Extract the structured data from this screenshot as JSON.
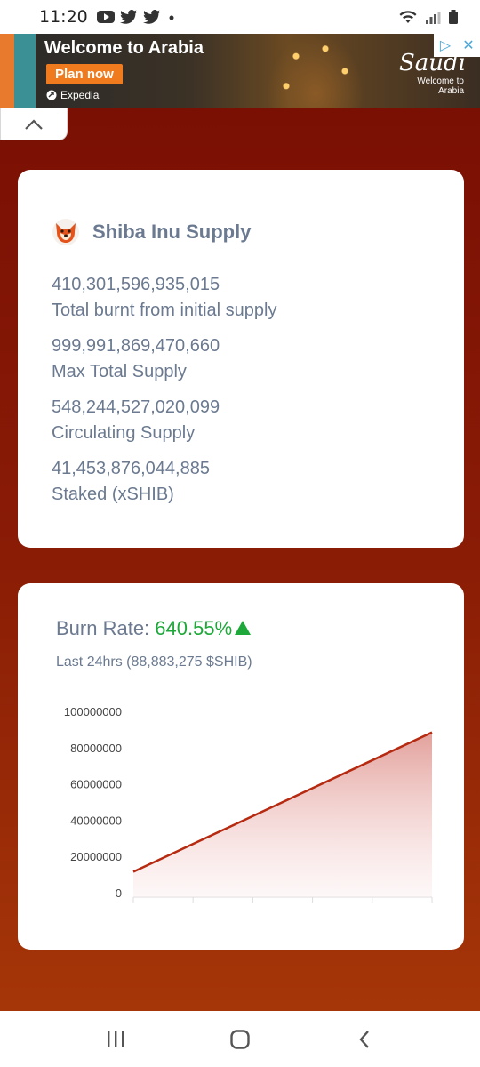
{
  "status_bar": {
    "time": "11:20",
    "left_icons": [
      "youtube-icon",
      "twitter-icon",
      "twitter-icon",
      "dot-icon"
    ],
    "right_icons": [
      "wifi-icon",
      "signal-icon",
      "battery-icon"
    ]
  },
  "ad": {
    "title": "Welcome to Arabia",
    "cta": "Plan now",
    "advertiser": "Expedia",
    "brand": "Saudi",
    "tagline": "Welcome to Arabia",
    "controls": [
      "adchoices-icon",
      "close-icon"
    ]
  },
  "supply_card": {
    "title": "Shiba Inu Supply",
    "stats": [
      {
        "value": "410,301,596,935,015",
        "label": "Total burnt from initial supply"
      },
      {
        "value": "999,991,869,470,660",
        "label": "Max Total Supply"
      },
      {
        "value": "548,244,527,020,099",
        "label": "Circulating Supply"
      },
      {
        "value": "41,453,876,044,885",
        "label": "Staked (xSHIB)"
      }
    ]
  },
  "burn_card": {
    "title_prefix": "Burn Rate: ",
    "rate": "640.55%",
    "subtitle": "Last 24hrs (88,883,275 $SHIB)",
    "trend_color": "#1fa83a"
  },
  "chart_data": {
    "type": "area",
    "x": [
      0,
      5
    ],
    "values": [
      12000000,
      88883275
    ],
    "ylim": [
      0,
      100000000
    ],
    "yticks": [
      0,
      20000000,
      40000000,
      60000000,
      80000000,
      100000000
    ],
    "ytick_labels": [
      "0",
      "20000000",
      "40000000",
      "60000000",
      "80000000",
      "100000000"
    ],
    "x_tick_count": 6,
    "line_color": "#b52a10",
    "title": "",
    "xlabel": "",
    "ylabel": ""
  },
  "colors": {
    "background_top": "#7a0f04",
    "background_bottom": "#a53608",
    "text_muted": "#6b7a90"
  },
  "nav": {
    "buttons": [
      "recent-apps-icon",
      "home-icon",
      "back-icon"
    ]
  }
}
